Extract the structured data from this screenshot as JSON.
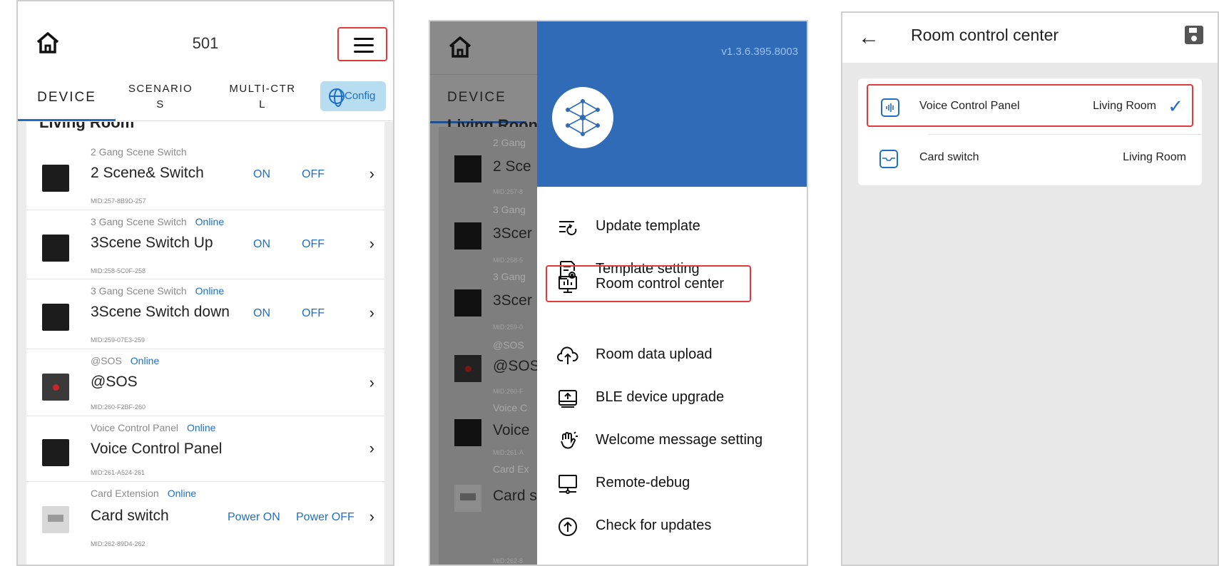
{
  "panel1": {
    "title": "501",
    "tabs": {
      "device": "DEVICE",
      "scenarios": "SCENARIO\nS",
      "multi": "MULTI-CTR\nL",
      "config": "Config"
    },
    "section": "Living Room",
    "rows": [
      {
        "type": "2 Gang Scene Switch",
        "online": "",
        "name": "2 Scene& Switch",
        "mid": "MID:257-8B9D-257",
        "on": "ON",
        "off": "OFF"
      },
      {
        "type": "3 Gang Scene Switch",
        "online": "Online",
        "name": "3Scene Switch Up",
        "mid": "MID:258-5C0F-258",
        "on": "ON",
        "off": "OFF"
      },
      {
        "type": "3 Gang Scene Switch",
        "online": "Online",
        "name": "3Scene Switch down",
        "mid": "MID:259-07E3-259",
        "on": "ON",
        "off": "OFF"
      },
      {
        "type": "@SOS",
        "online": "Online",
        "name": "@SOS",
        "mid": "MID:260-F2BF-260",
        "on": "",
        "off": ""
      },
      {
        "type": "Voice Control Panel",
        "online": "Online",
        "name": "Voice Control Panel",
        "mid": "MID:261-A524-261",
        "on": "",
        "off": ""
      },
      {
        "type": "Card Extension",
        "online": "Online",
        "name": "Card switch",
        "mid": "MID:262-89D4-262",
        "on": "Power ON",
        "off": "Power OFF"
      }
    ]
  },
  "panel2": {
    "tab": "DEVICE",
    "version": "v1.3.6.395.8003",
    "menu": [
      {
        "label": "Update template",
        "icon": "update-template-icon"
      },
      {
        "label": "Template setting",
        "icon": "template-setting-icon"
      },
      {
        "label": "Room control center",
        "icon": "room-control-icon"
      },
      {
        "label": "Room data upload",
        "icon": "cloud-upload-icon"
      },
      {
        "label": "BLE device upgrade",
        "icon": "ble-upgrade-icon"
      },
      {
        "label": "Welcome message setting",
        "icon": "welcome-hand-icon"
      },
      {
        "label": "Remote-debug",
        "icon": "remote-debug-icon"
      },
      {
        "label": "Check for updates",
        "icon": "check-updates-icon"
      }
    ],
    "dim_rows": [
      {
        "type": "2 Gang",
        "name": "2 Sce",
        "mid": "MID:257-8"
      },
      {
        "type": "3 Gang",
        "name": "3Scer",
        "mid": "MID:258-5"
      },
      {
        "type": "3 Gang",
        "name": "3Scer",
        "mid": "MID:259-0"
      },
      {
        "type": "@SOS",
        "name": "@SOS",
        "mid": "MID:260-F"
      },
      {
        "type": "Voice C",
        "name": "Voice",
        "mid": "MID:261-A"
      },
      {
        "type": "Card Ex",
        "name": "Card s",
        "mid": "MID:262-8"
      }
    ],
    "section": "Living Roon"
  },
  "panel3": {
    "title": "Room control center",
    "rows": [
      {
        "name": "Voice Control Panel",
        "room": "Living Room",
        "checked": true
      },
      {
        "name": "Card switch",
        "room": "Living Room",
        "checked": false
      }
    ]
  },
  "colors": {
    "accent": "#1e6fc4",
    "highlight": "#e03b3b",
    "drawer_header": "#2f6bb7"
  }
}
